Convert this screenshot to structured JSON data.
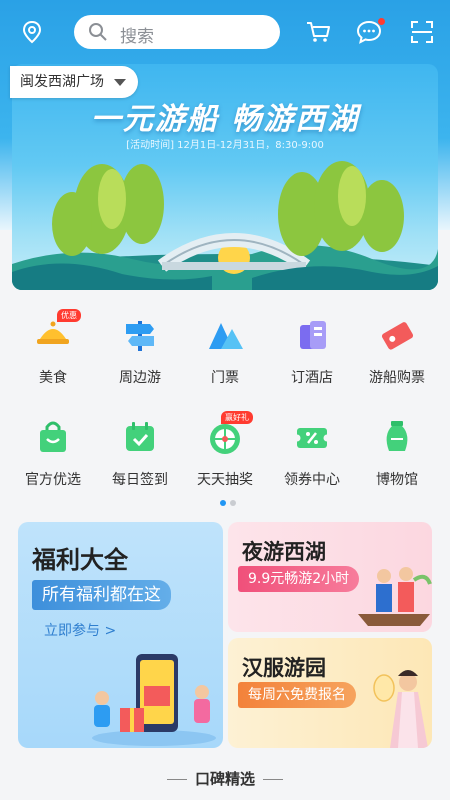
{
  "header": {
    "search_placeholder": "搜索",
    "location": "闽发西湖广场",
    "icons": [
      "location-pin-icon",
      "search-icon",
      "cart-icon",
      "message-icon",
      "scan-icon"
    ],
    "accent": "#2aa1e6"
  },
  "banner": {
    "title": "一元游船  畅游西湖",
    "subtitle": "[活动时间] 12月1日-12月31日，8:30-9:00"
  },
  "grid": {
    "items": [
      {
        "label": "美食",
        "icon": "food-icon",
        "badge": "优惠"
      },
      {
        "label": "周边游",
        "icon": "signpost-icon",
        "badge": ""
      },
      {
        "label": "门票",
        "icon": "mountain-icon",
        "badge": ""
      },
      {
        "label": "订酒店",
        "icon": "hotel-icon",
        "badge": ""
      },
      {
        "label": "游船购票",
        "icon": "ticket-icon",
        "badge": ""
      },
      {
        "label": "官方优选",
        "icon": "shopping-bag-icon",
        "badge": ""
      },
      {
        "label": "每日签到",
        "icon": "calendar-icon",
        "badge": ""
      },
      {
        "label": "天天抽奖",
        "icon": "lottery-wheel-icon",
        "badge": "赢好礼"
      },
      {
        "label": "领券中心",
        "icon": "coupon-icon",
        "badge": ""
      },
      {
        "label": "博物馆",
        "icon": "vase-icon",
        "badge": ""
      }
    ],
    "page_dots": {
      "count": 2,
      "active": 0
    }
  },
  "promos": {
    "fuli": {
      "title": "福利大全",
      "pill": "所有福利都在这",
      "link": "立即参与 >"
    },
    "ye": {
      "title": "夜游西湖",
      "pill": "9.9元畅游2小时"
    },
    "han": {
      "title": "汉服游园",
      "pill": "每周六免费报名"
    }
  },
  "section": {
    "title": "口碑精选"
  }
}
